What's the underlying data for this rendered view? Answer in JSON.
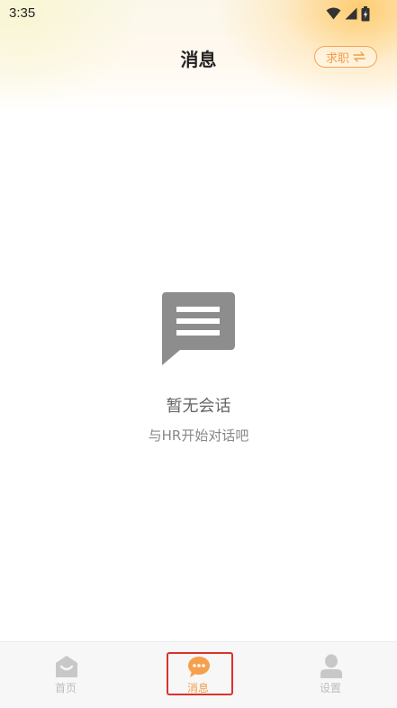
{
  "status_bar": {
    "time": "3:35"
  },
  "header": {
    "title": "消息",
    "switch_label": "求职",
    "switch_icon": "swap-arrows-icon"
  },
  "empty_state": {
    "title": "暂无会话",
    "subtitle": "与HR开始对话吧",
    "icon": "message-bubble-icon"
  },
  "tabbar": {
    "tabs": [
      {
        "label": "首页",
        "icon": "home-icon",
        "active": false
      },
      {
        "label": "消息",
        "icon": "chat-bubble-icon",
        "active": true
      },
      {
        "label": "设置",
        "icon": "person-icon",
        "active": false
      }
    ]
  },
  "colors": {
    "accent": "#f29d4a",
    "highlight": "#d9332b",
    "inactive": "#bdbdbd"
  }
}
